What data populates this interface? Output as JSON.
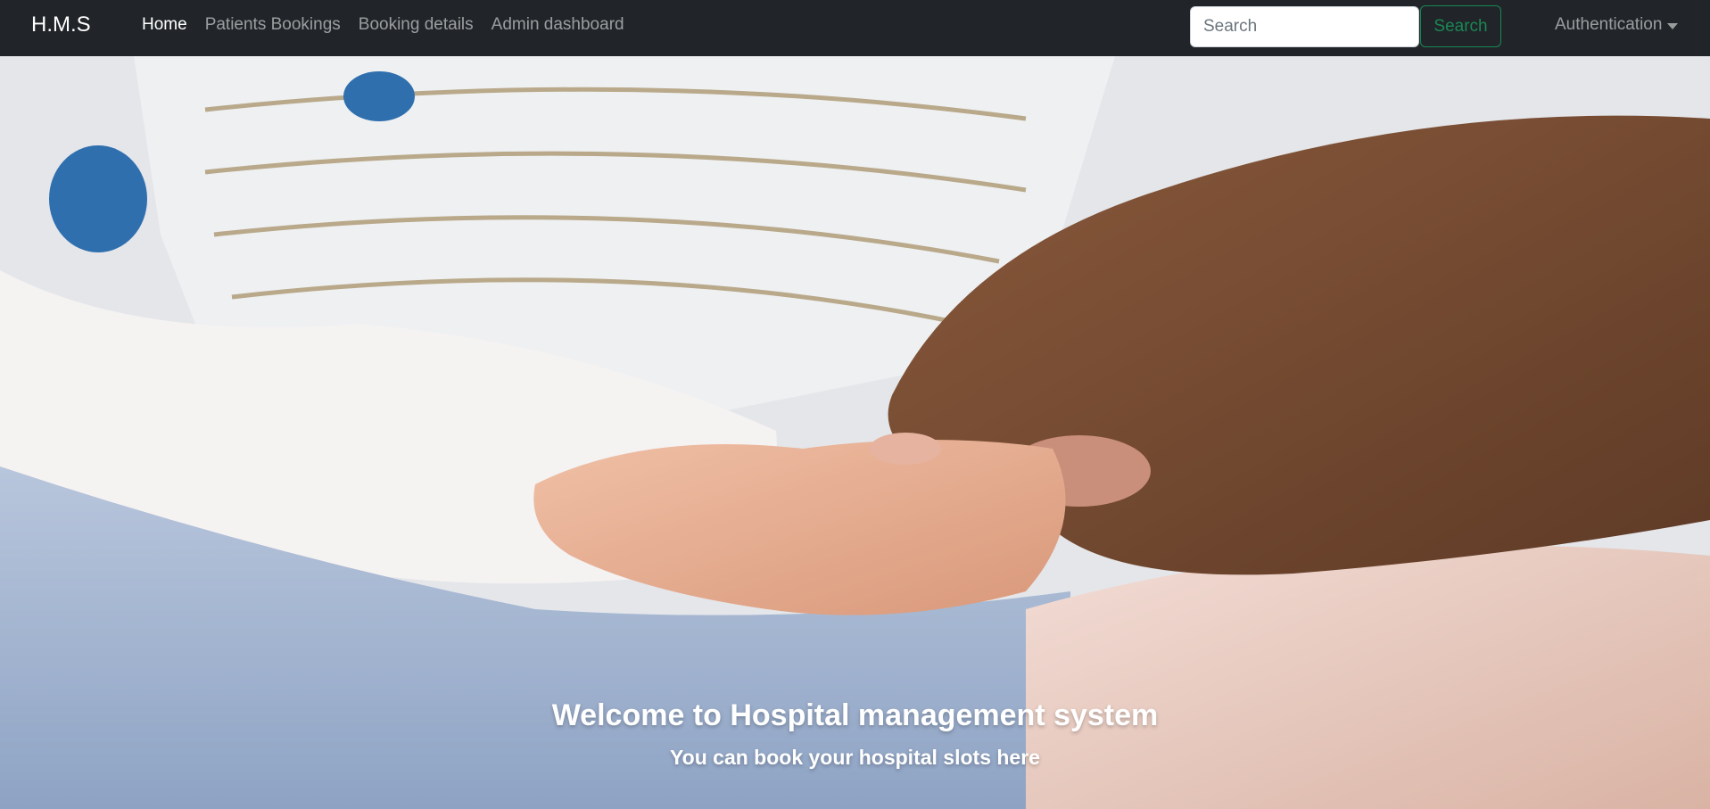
{
  "navbar": {
    "brand": "H.M.S",
    "links": [
      {
        "label": "Home",
        "active": true
      },
      {
        "label": "Patients Bookings",
        "active": false
      },
      {
        "label": "Booking details",
        "active": false
      },
      {
        "label": "Admin dashboard",
        "active": false
      }
    ],
    "search": {
      "placeholder": "Search",
      "value": "",
      "button_label": "Search"
    },
    "auth_dropdown": "Authentication"
  },
  "hero": {
    "image": "hands-holding-baby-photo",
    "title": "Welcome to Hospital management system",
    "subtitle": "You can book your hospital slots here"
  },
  "colors": {
    "navbar_bg": "#212529",
    "link_muted": "rgba(255,255,255,0.55)",
    "search_button": "#198754"
  }
}
